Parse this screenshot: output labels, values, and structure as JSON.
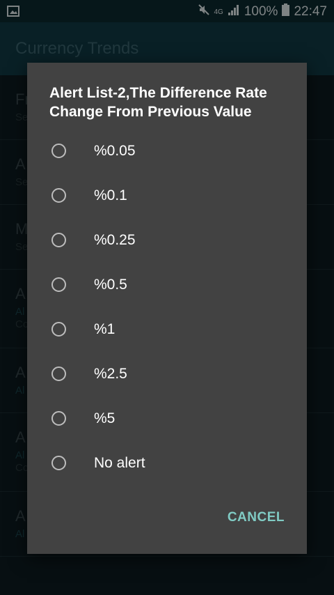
{
  "status_bar": {
    "network": "4G",
    "battery_percent": "100%",
    "time": "22:47",
    "icons": [
      "image-notification-icon",
      "mute-icon",
      "signal-icon",
      "battery-icon"
    ]
  },
  "app_bar": {
    "title": "Currency Trends"
  },
  "background_list": {
    "rows": [
      {
        "title": "Fr",
        "sub": "Se"
      },
      {
        "title": "A",
        "sub": "Se"
      },
      {
        "title": "M",
        "sub": "Se"
      },
      {
        "title": "A",
        "sub": "Al",
        "sub2": "Co"
      },
      {
        "title": "A",
        "sub": "Al"
      },
      {
        "title": "A",
        "sub": "Al",
        "sub2": "Co"
      },
      {
        "title": "A",
        "sub": "Al"
      }
    ]
  },
  "dialog": {
    "title": "Alert List-2,The Difference Rate Change From Previous Value",
    "options": [
      "%0.05",
      "%0.1",
      "%0.25",
      "%0.5",
      "%1",
      "%2.5",
      "%5",
      "No alert"
    ],
    "cancel_label": "CANCEL"
  },
  "colors": {
    "accent": "#80cbc4",
    "dialog_bg": "#424242",
    "app_bar": "#113b46"
  }
}
